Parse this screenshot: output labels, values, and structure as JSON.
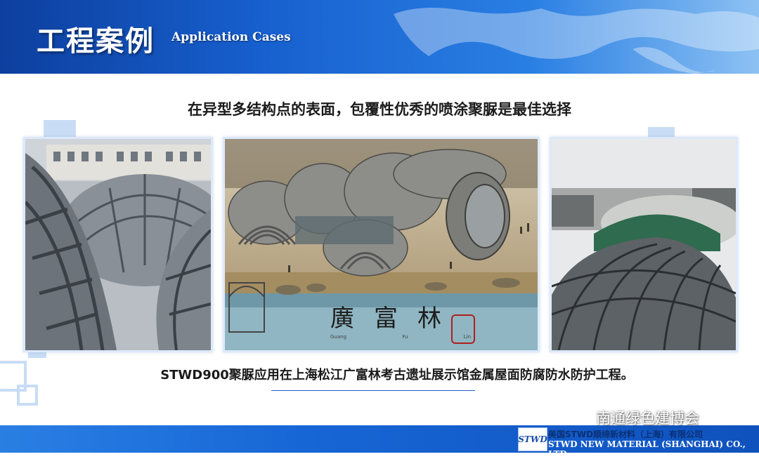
{
  "header": {
    "title_zh": "工程案例",
    "title_en": "Application Cases"
  },
  "headline": "在异型多结构点的表面，包覆性优秀的喷涂聚脲是最佳选择",
  "photos": {
    "left": {
      "alt": "steel frame dome roofs"
    },
    "center": {
      "alt": "museum rendering with dome roofs",
      "sign_text": "廣富林",
      "sign_sub": [
        "Guang",
        "Fu",
        "Lin"
      ]
    },
    "right": {
      "alt": "ribbed metal roof domes"
    }
  },
  "caption": "STWD900聚脲应用在上海松江广富林考古遗址展示馆金属屋面防腐防水防护工程。",
  "footer": {
    "logo": "STWD",
    "company_zh": "美国STWD顺缔新材料（上海）有限公司",
    "company_en": "STWD NEW MATERIAL (SHANGHAI) CO., LTD."
  },
  "watermark": {
    "icon": "wechat-icon",
    "text": "南通绿色建博会"
  },
  "colors": {
    "header_blue": "#1760cf",
    "footer_blue": "#1766d6",
    "deco": "#c8dcf5"
  }
}
